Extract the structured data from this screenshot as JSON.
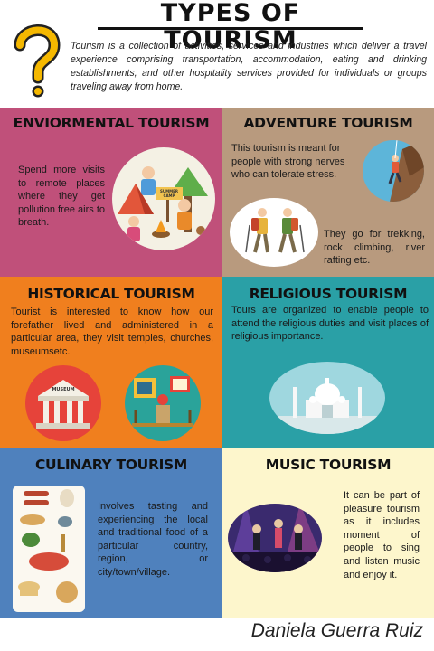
{
  "header": {
    "title": "TYPES OF TOURISM",
    "intro": "Tourism is a collection of activities, services and industries which deliver a travel experience comprising transportation, accommodation, eating and drinking establishments, and other hospitality services provided for individuals or groups traveling away from home."
  },
  "sections": {
    "environmental": {
      "title": "ENVIORMENTAL TOURISM",
      "text": "Spend more visits to remote places where they get pollution free airs to breath.",
      "sign_text": "SUMMER CAMP",
      "color": "#c0507a"
    },
    "adventure": {
      "title": "ADVENTURE TOURISM",
      "text1": "This tourism is meant for people with strong nerves who can tolerate stress.",
      "text2": "They go for trekking, rock climbing, river rafting etc.",
      "color": "#b89a7e"
    },
    "historical": {
      "title": "HISTORICAL TOURISM",
      "text": "Tourist is interested to know how our forefather lived and administered in a particular area, they visit temples, churches, museumsetc.",
      "museum_sign": "MUSEUM",
      "color": "#f07f1e"
    },
    "religious": {
      "title": "RELIGIOUS TOURISM",
      "text": "Tours are organized to enable people to attend the religious duties and visit places of religious importance.",
      "color": "#2aa0a6"
    },
    "culinary": {
      "title": "CULINARY TOURISM",
      "text": "Involves tasting and experiencing the local and traditional food of a particular country, region, or city/town/village.",
      "color": "#4f81bd"
    },
    "music": {
      "title": "MUSIC TOURISM",
      "text": "It can be part of pleasure tourism as it includes moment of people to sing and listen music and enjoy it.",
      "color": "#fdf6cc"
    }
  },
  "author": "Daniela Guerra Ruiz"
}
